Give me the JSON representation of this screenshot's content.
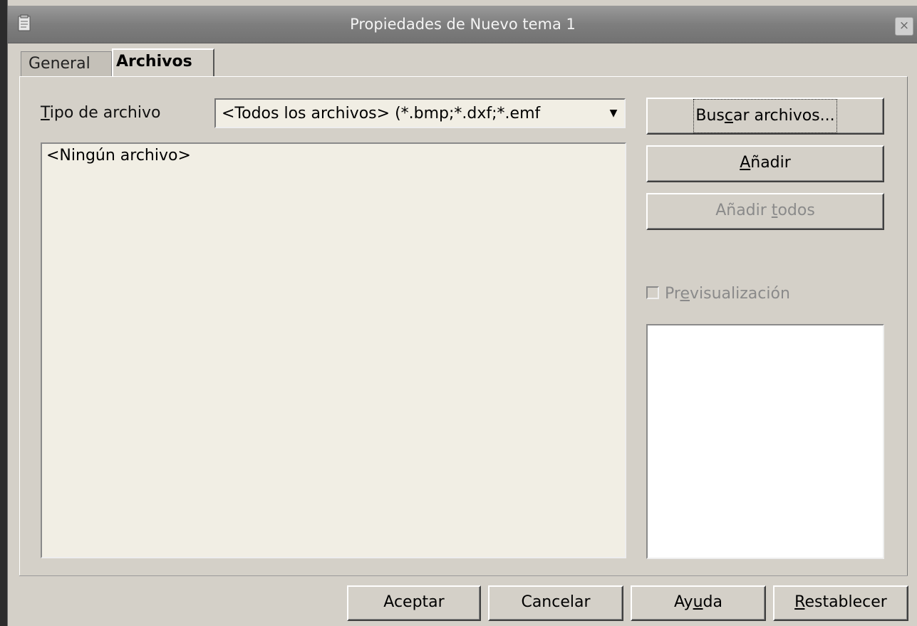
{
  "window": {
    "title": "Propiedades de Nuevo tema 1",
    "icon": "document-icon",
    "close_glyph": "×"
  },
  "tabs": [
    {
      "label": "General",
      "active": false
    },
    {
      "label": "Archivos",
      "active": true
    }
  ],
  "filetype": {
    "label_mnemonic": "T",
    "label_rest": "ipo de archivo",
    "value": "<Todos los archivos> (*.bmp;*.dxf;*.emf"
  },
  "file_list": {
    "items": [
      "<Ningún archivo>"
    ]
  },
  "buttons": {
    "search_pre": "Bus",
    "search_mn": "c",
    "search_post": "ar archivos...",
    "add_mn": "A",
    "add_post": "ñadir",
    "add_all_pre": "Añadir ",
    "add_all_mn": "t",
    "add_all_post": "odos"
  },
  "preview": {
    "label_pre": "Pr",
    "label_mn": "e",
    "label_post": "visualización",
    "checked": false,
    "enabled": false
  },
  "dialog_buttons": {
    "ok": "Aceptar",
    "cancel": "Cancelar",
    "help_pre": "Ay",
    "help_mn": "u",
    "help_post": "da",
    "reset_mn": "R",
    "reset_post": "establecer"
  },
  "colors": {
    "dialog_bg": "#d4d0c8",
    "titlebar": "#7e7e7e",
    "input_bg": "#f1eee4",
    "disabled_text": "#8a8a8a"
  }
}
